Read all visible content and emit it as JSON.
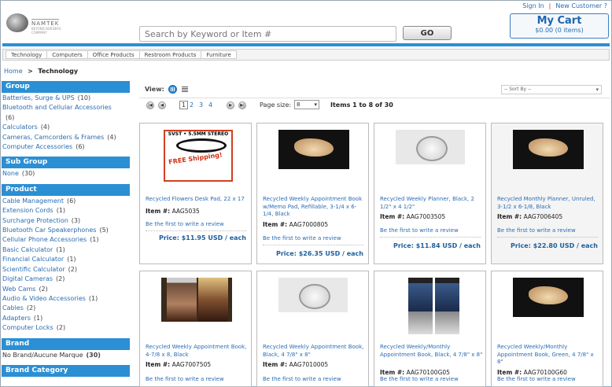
{
  "header": {
    "sign_in": "Sign In",
    "separator": "|",
    "new_customer": "New Customer ?",
    "logo_text": "NAMTEK",
    "logo_sub": "BEYOND BORDERS COMPANY",
    "search_placeholder": "Search by Keyword or Item #",
    "go_label": "GO",
    "cart_title": "My Cart",
    "cart_total": "$0.00 (0 items)"
  },
  "nav": [
    "Technology",
    "Computers",
    "Office Products",
    "Restroom Products",
    "Furniture"
  ],
  "breadcrumb": {
    "home": "Home",
    "sep": ">",
    "current": "Technology"
  },
  "sidebar": {
    "group": {
      "title": "Group",
      "items": [
        {
          "label": "Batteries, Surge & UPS",
          "count": "(10)"
        },
        {
          "label": "Bluetooth and Cellular Accessories",
          "count": "(6)"
        },
        {
          "label": "Calculators",
          "count": "(4)"
        },
        {
          "label": "Cameras, Camcorders & Frames",
          "count": "(4)"
        },
        {
          "label": "Computer Accessories",
          "count": "(6)"
        }
      ]
    },
    "subgroup": {
      "title": "Sub Group",
      "items": [
        {
          "label": "None",
          "count": "(30)"
        }
      ]
    },
    "product": {
      "title": "Product",
      "items": [
        {
          "label": "Cable Management",
          "count": "(6)"
        },
        {
          "label": "Extension Cords",
          "count": "(1)"
        },
        {
          "label": "Surcharge Protection",
          "count": "(3)"
        },
        {
          "label": "Bluetooth Car Speakerphones",
          "count": "(5)"
        },
        {
          "label": "Cellular Phone Accessories",
          "count": "(1)"
        },
        {
          "label": "Basic Calculator",
          "count": "(1)"
        },
        {
          "label": "Financial Calculator",
          "count": "(1)"
        },
        {
          "label": "Scientific Calculator",
          "count": "(2)"
        },
        {
          "label": "Digital Cameras",
          "count": "(2)"
        },
        {
          "label": "Web Cams",
          "count": "(2)"
        },
        {
          "label": "Audio & Video Accessories",
          "count": "(1)"
        },
        {
          "label": "Cables",
          "count": "(2)"
        },
        {
          "label": "Adapters",
          "count": "(1)"
        },
        {
          "label": "Computer Locks",
          "count": "(2)"
        }
      ]
    },
    "brand": {
      "title": "Brand",
      "items": [
        {
          "label": "No Brand/Aucune Marque",
          "count": "(30)"
        }
      ]
    },
    "brand_category": {
      "title": "Brand Category"
    }
  },
  "toolbar": {
    "view_label": "View:",
    "sort_by": "-- Sort By --",
    "pages": [
      "1",
      "2",
      "3",
      "4"
    ],
    "page_size_label": "Page size:",
    "page_size": "8",
    "items_count": "Items 1 to 8 of 30"
  },
  "products": [
    {
      "name": "Recycled Flowers Desk Pad, 22 x 17",
      "item_label": "Item #:",
      "item": "AAG5035",
      "review": "Be the first to write a review",
      "price": "Price: $11.95 USD / each",
      "image": "cable-image",
      "img_header": "SVST • 5.5MM STEREO",
      "img_badge": "FREE Shipping!"
    },
    {
      "name": "Recycled Weekly Appointment Book w/Memo Pad, Refillable, 3-1/4 x 6-1/4, Black",
      "item_label": "Item #:",
      "item": "AAG7000805",
      "review": "Be the first to write a review",
      "price": "Price: $26.35 USD / each",
      "image": "shoe-image"
    },
    {
      "name": "Recycled Weekly Planner, Black, 2 1/2\" x 4 1/2\"",
      "item_label": "Item #:",
      "item": "AAG7003505",
      "review": "Be the first to write a review",
      "price": "Price: $11.84 USD / each",
      "image": "dish-image"
    },
    {
      "name": "Recycled Monthly Planner, Unruled, 3-1/2 x 6-1/8, Black",
      "item_label": "Item #:",
      "item": "AAG7006405",
      "review": "Be the first to write a review",
      "price": "Price: $22.80 USD / each",
      "image": "shoe-image"
    },
    {
      "name": "Recycled Weekly Appointment Book, 4-7/8 x 8, Black",
      "item_label": "Item #:",
      "item": "AAG7007505",
      "review": "Be the first to write a review",
      "image": "movie-image"
    },
    {
      "name": "Recycled Weekly Appointment Book, Black, 4 7/8\" x 8\"",
      "item_label": "Item #:",
      "item": "AAG7010005",
      "review": "Be the first to write a review",
      "image": "dish-image"
    },
    {
      "name": "Recycled Weekly/Monthly Appointment Book, Black, 4 7/8\" x 8\"",
      "item_label": "Item #:",
      "item": "AAG70100G05",
      "review": "Be the first to write a review",
      "image": "poster-image"
    },
    {
      "name": "Recycled Weekly/Monthly Appointment Book, Green, 4 7/8\" x 8\"",
      "item_label": "Item #:",
      "item": "AAG70100G60",
      "review": "Be the first to write a review",
      "image": "shoe-image"
    }
  ]
}
